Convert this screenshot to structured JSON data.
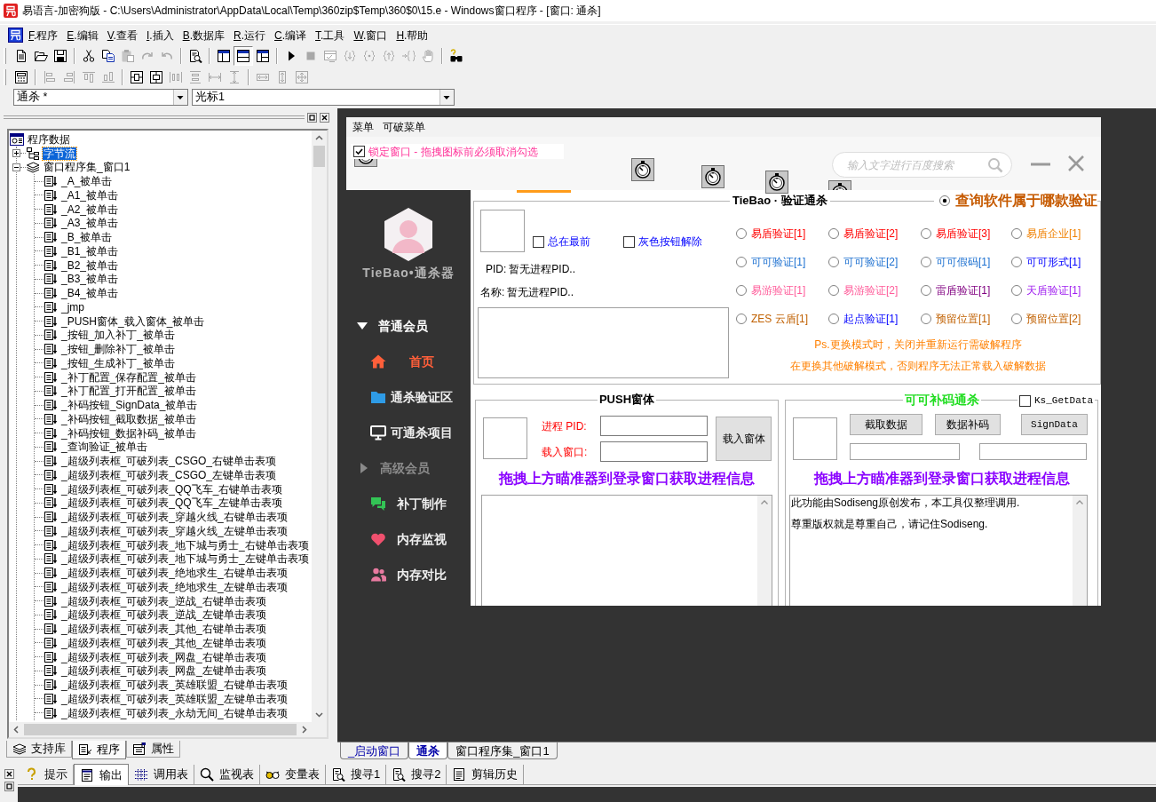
{
  "title_bar": {
    "title": "易语言-加密狗版 - C:\\Users\\Administrator\\AppData\\Local\\Temp\\360zip$Temp\\360$0\\15.e - Windows窗口程序 - [窗口: 通杀]"
  },
  "menu_bar": {
    "items": [
      "F.程序",
      "E.编辑",
      "V.查看",
      "I.插入",
      "B.数据库",
      "R.运行",
      "C.编译",
      "T.工具",
      "W.窗口",
      "H.帮助"
    ]
  },
  "toolbars": [
    {
      "groups": [
        {
          "items": [
            {
              "kind": "new",
              "disabled": false,
              "pressed": false
            },
            {
              "kind": "open",
              "disabled": false,
              "pressed": false
            },
            {
              "kind": "save",
              "disabled": false,
              "pressed": false
            }
          ]
        },
        {
          "items": [
            {
              "kind": "cut",
              "disabled": false,
              "pressed": false
            },
            {
              "kind": "copy",
              "disabled": false,
              "pressed": false
            },
            {
              "kind": "paste",
              "disabled": true,
              "pressed": false
            },
            {
              "kind": "redo",
              "disabled": true,
              "pressed": false
            },
            {
              "kind": "undo",
              "disabled": true,
              "pressed": false
            }
          ]
        },
        {
          "items": [
            {
              "kind": "preview",
              "disabled": false,
              "pressed": false
            }
          ]
        },
        {
          "items": [
            {
              "kind": "layoutleft",
              "disabled": false,
              "pressed": false
            },
            {
              "kind": "layouttop",
              "disabled": false,
              "pressed": true
            },
            {
              "kind": "layoutsplit",
              "disabled": false,
              "pressed": false
            }
          ]
        },
        {
          "items": [
            {
              "kind": "run",
              "disabled": false,
              "pressed": false
            },
            {
              "kind": "stop",
              "disabled": true,
              "pressed": false
            },
            {
              "kind": "watch",
              "disabled": true,
              "pressed": false
            },
            {
              "kind": "stepinto",
              "disabled": true,
              "pressed": false
            },
            {
              "kind": "stepover",
              "disabled": true,
              "pressed": false
            },
            {
              "kind": "stepout",
              "disabled": true,
              "pressed": false
            },
            {
              "kind": "runto",
              "disabled": true,
              "pressed": false
            },
            {
              "kind": "hand",
              "disabled": true,
              "pressed": false
            }
          ]
        },
        {
          "items": [
            {
              "kind": "finder",
              "disabled": false,
              "pressed": false
            }
          ]
        }
      ]
    },
    {
      "groups": [
        {
          "items": [
            {
              "kind": "form",
              "disabled": false,
              "pressed": false
            }
          ]
        },
        {
          "items": [
            {
              "kind": "alignleft",
              "disabled": true,
              "pressed": false
            },
            {
              "kind": "alignright",
              "disabled": true,
              "pressed": false
            },
            {
              "kind": "aligntop",
              "disabled": true,
              "pressed": false
            },
            {
              "kind": "alignbottom",
              "disabled": true,
              "pressed": false
            }
          ]
        },
        {
          "items": [
            {
              "kind": "centerh",
              "disabled": false,
              "pressed": false
            },
            {
              "kind": "centerv",
              "disabled": false,
              "pressed": false
            },
            {
              "kind": "spaceh",
              "disabled": true,
              "pressed": false
            },
            {
              "kind": "spacev",
              "disabled": true,
              "pressed": false
            },
            {
              "kind": "distributeh",
              "disabled": true,
              "pressed": false
            },
            {
              "kind": "distributev",
              "disabled": true,
              "pressed": false
            }
          ]
        },
        {
          "items": [
            {
              "kind": "samewidth",
              "disabled": true,
              "pressed": false
            },
            {
              "kind": "sameheight",
              "disabled": true,
              "pressed": false
            },
            {
              "kind": "samesize",
              "disabled": true,
              "pressed": false
            }
          ]
        }
      ]
    }
  ],
  "dropdowns": [
    {
      "value": "通杀 *"
    },
    {
      "value": "光标1"
    }
  ],
  "program_panel": {
    "tree": {
      "label": "程序数据",
      "kind": "data",
      "selected": false,
      "children": [
        {
          "label": "字节流",
          "kind": "struct",
          "expanded": false,
          "selected": true
        },
        {
          "label": "窗口程序集_窗口1",
          "kind": "assembly",
          "expanded": true,
          "selected": false,
          "children": [
            {
              "label": "_A_被单击",
              "kind": "method",
              "selected": false
            },
            {
              "label": "_A1_被单击",
              "kind": "method",
              "selected": false
            },
            {
              "label": "_A2_被单击",
              "kind": "method",
              "selected": false
            },
            {
              "label": "_A3_被单击",
              "kind": "method",
              "selected": false
            },
            {
              "label": "_B_被单击",
              "kind": "method",
              "selected": false
            },
            {
              "label": "_B1_被单击",
              "kind": "method",
              "selected": false
            },
            {
              "label": "_B2_被单击",
              "kind": "method",
              "selected": false
            },
            {
              "label": "_B3_被单击",
              "kind": "method",
              "selected": false
            },
            {
              "label": "_B4_被单击",
              "kind": "method",
              "selected": false
            },
            {
              "label": "_jmp",
              "kind": "method",
              "selected": false
            },
            {
              "label": "_PUSH窗体_载入窗体_被单击",
              "kind": "method",
              "selected": false
            },
            {
              "label": "_按钮_加入补丁_被单击",
              "kind": "method",
              "selected": false
            },
            {
              "label": "_按钮_删除补丁_被单击",
              "kind": "method",
              "selected": false
            },
            {
              "label": "_按钮_生成补丁_被单击",
              "kind": "method",
              "selected": false
            },
            {
              "label": "_补丁配置_保存配置_被单击",
              "kind": "method",
              "selected": false
            },
            {
              "label": "_补丁配置_打开配置_被单击",
              "kind": "method",
              "selected": false
            },
            {
              "label": "_补码按钮_SignData_被单击",
              "kind": "method",
              "selected": false
            },
            {
              "label": "_补码按钮_截取数据_被单击",
              "kind": "method",
              "selected": false
            },
            {
              "label": "_补码按钮_数据补码_被单击",
              "kind": "method",
              "selected": false
            },
            {
              "label": "_查询验证_被单击",
              "kind": "method",
              "selected": false
            },
            {
              "label": "_超级列表框_可破列表_CSGO_右键单击表项",
              "kind": "method",
              "selected": false
            },
            {
              "label": "_超级列表框_可破列表_CSGO_左键单击表项",
              "kind": "method",
              "selected": false
            },
            {
              "label": "_超级列表框_可破列表_QQ飞车_右键单击表项",
              "kind": "method",
              "selected": false
            },
            {
              "label": "_超级列表框_可破列表_QQ飞车_左键单击表项",
              "kind": "method",
              "selected": false
            },
            {
              "label": "_超级列表框_可破列表_穿越火线_右键单击表项",
              "kind": "method",
              "selected": false
            },
            {
              "label": "_超级列表框_可破列表_穿越火线_左键单击表项",
              "kind": "method",
              "selected": false
            },
            {
              "label": "_超级列表框_可破列表_地下城与勇士_右键单击表项",
              "kind": "method",
              "selected": false
            },
            {
              "label": "_超级列表框_可破列表_地下城与勇士_左键单击表项",
              "kind": "method",
              "selected": false
            },
            {
              "label": "_超级列表框_可破列表_绝地求生_右键单击表项",
              "kind": "method",
              "selected": false
            },
            {
              "label": "_超级列表框_可破列表_绝地求生_左键单击表项",
              "kind": "method",
              "selected": false
            },
            {
              "label": "_超级列表框_可破列表_逆战_右键单击表项",
              "kind": "method",
              "selected": false
            },
            {
              "label": "_超级列表框_可破列表_逆战_左键单击表项",
              "kind": "method",
              "selected": false
            },
            {
              "label": "_超级列表框_可破列表_其他_右键单击表项",
              "kind": "method",
              "selected": false
            },
            {
              "label": "_超级列表框_可破列表_其他_左键单击表项",
              "kind": "method",
              "selected": false
            },
            {
              "label": "_超级列表框_可破列表_网盘_右键单击表项",
              "kind": "method",
              "selected": false
            },
            {
              "label": "_超级列表框_可破列表_网盘_左键单击表项",
              "kind": "method",
              "selected": false
            },
            {
              "label": "_超级列表框_可破列表_英雄联盟_右键单击表项",
              "kind": "method",
              "selected": false
            },
            {
              "label": "_超级列表框_可破列表_英雄联盟_左键单击表项",
              "kind": "method",
              "selected": false
            },
            {
              "label": "_超级列表框_可破列表_永劫无间_右键单击表项",
              "kind": "method",
              "selected": false
            }
          ]
        }
      ]
    },
    "tabs": [
      {
        "label": "支持库",
        "kind": "library",
        "selected": false
      },
      {
        "label": "程序",
        "kind": "program",
        "selected": true
      },
      {
        "label": "属性",
        "kind": "properties",
        "selected": false
      }
    ]
  },
  "designer_form": {
    "menu": [
      "菜单",
      "可破菜单"
    ],
    "lock_checkbox": {
      "label": "锁定窗口 - 拖拽图标前必须取消勾选",
      "checked": true
    },
    "search_field": {
      "placeholder": "输入文字进行百度搜索"
    },
    "sidebar": {
      "brand": "TieBao•通杀器",
      "items": [
        {
          "kind": "section",
          "label": "普通会员",
          "expanded": true,
          "selected": false
        },
        {
          "kind": "home",
          "label": "首页",
          "selected": true
        },
        {
          "kind": "folder",
          "label": "通杀验证区",
          "selected": false
        },
        {
          "kind": "monitor",
          "label": "可通杀项目",
          "selected": false
        },
        {
          "kind": "section",
          "label": "高级会员",
          "expanded": false,
          "selected": false
        },
        {
          "kind": "chat",
          "label": "补丁制作",
          "selected": false
        },
        {
          "kind": "heart",
          "label": "内存监视",
          "selected": false
        },
        {
          "kind": "people",
          "label": "内存对比",
          "selected": false
        }
      ]
    },
    "verify_group": {
      "title": "TieBao · 验证通杀",
      "query_radio": {
        "label": "查询软件属于哪款验证",
        "selected": true
      },
      "checkboxes": [
        {
          "label": "总在最前",
          "checked": false
        },
        {
          "label": "灰色按钮解除",
          "checked": false
        }
      ],
      "info": [
        {
          "label": "PID:",
          "value": "暂无进程PID.."
        },
        {
          "label": "名称:",
          "value": "暂无进程PID.."
        }
      ],
      "options": [
        {
          "label": "易盾验证[1]",
          "color": "#ff0000",
          "selected": false
        },
        {
          "label": "易盾验证[2]",
          "color": "#ff0000",
          "selected": false
        },
        {
          "label": "易盾验证[3]",
          "color": "#ff0000",
          "selected": false
        },
        {
          "label": "易盾企业[1]",
          "color": "#f08000",
          "selected": false
        },
        {
          "label": "可可验证[1]",
          "color": "#1a6fd0",
          "selected": false
        },
        {
          "label": "可可验证[2]",
          "color": "#1a6fd0",
          "selected": false
        },
        {
          "label": "可可假码[1]",
          "color": "#1a6fd0",
          "selected": false
        },
        {
          "label": "可可形式[1]",
          "color": "#0000ff",
          "selected": false
        },
        {
          "label": "易游验证[1]",
          "color": "#ff5c9a",
          "selected": false
        },
        {
          "label": "易游验证[2]",
          "color": "#ff5c9a",
          "selected": false
        },
        {
          "label": "雷盾验证[1]",
          "color": "#800080",
          "selected": false
        },
        {
          "label": "天盾验证[1]",
          "color": "#a020f0",
          "selected": false
        },
        {
          "label": "ZES 云盾[1]",
          "color": "#c06000",
          "selected": false
        },
        {
          "label": "起点验证[1]",
          "color": "#0000ff",
          "selected": false
        },
        {
          "label": "预留位置[1]",
          "color": "#c06000",
          "selected": false
        },
        {
          "label": "预留位置[2]",
          "color": "#c06000",
          "selected": false
        }
      ],
      "notes": [
        "Ps.更换模式时，关闭并重新运行需破解程序",
        "在更换其他破解模式，否则程序无法正常载入破解数据"
      ]
    },
    "push_group": {
      "title": "PUSH窗体",
      "fields": [
        {
          "label": "进程 PID:"
        },
        {
          "label": "载入窗口:"
        }
      ],
      "button": "载入窗体",
      "hint": "拖拽上方瞄准器到登录窗口获取进程信息"
    },
    "patch_group": {
      "title": "可可补码通杀",
      "checkbox": {
        "label": "Ks_GetData",
        "checked": false
      },
      "buttons": [
        "截取数据",
        "数据补码",
        "SignData"
      ],
      "hint": "拖拽上方瞄准器到登录窗口获取进程信息",
      "log": [
        "此功能由Sodiseng原创发布，本工具仅整理调用.",
        "尊重版权就是尊重自己，请记住Sodiseng."
      ]
    }
  },
  "document_tabs": [
    {
      "label": "_启动窗口",
      "kind": "form",
      "selected": false
    },
    {
      "label": "通杀",
      "kind": "form",
      "selected": true
    },
    {
      "label": "窗口程序集_窗口1",
      "kind": "code",
      "selected": false
    }
  ],
  "output_panel": {
    "tabs": [
      {
        "label": "提示",
        "kind": "hint",
        "selected": false
      },
      {
        "label": "输出",
        "kind": "output",
        "selected": true
      },
      {
        "label": "调用表",
        "kind": "calls",
        "selected": false
      },
      {
        "label": "监视表",
        "kind": "watch",
        "selected": false
      },
      {
        "label": "变量表",
        "kind": "variables",
        "selected": false
      },
      {
        "label": "搜寻1",
        "kind": "search",
        "selected": false
      },
      {
        "label": "搜寻2",
        "kind": "search",
        "selected": false
      },
      {
        "label": "剪辑历史",
        "kind": "clipboard",
        "selected": false
      }
    ]
  }
}
